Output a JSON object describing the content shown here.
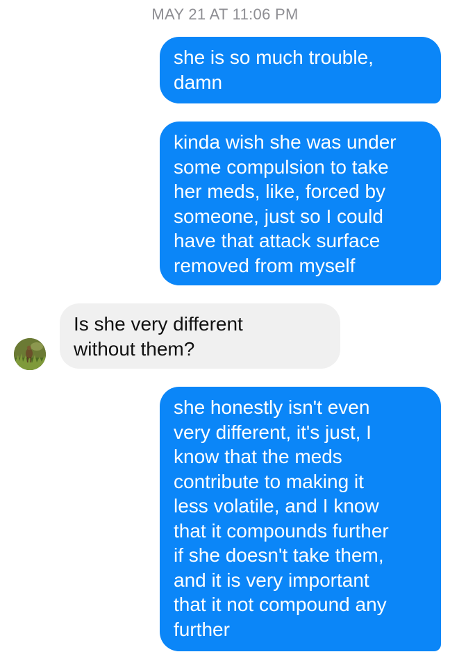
{
  "conversation": {
    "timestamp": "MAY 21 AT 11:06 PM",
    "messages": [
      {
        "direction": "outgoing",
        "lines": [
          "she is so much trouble,",
          "damn"
        ]
      },
      {
        "direction": "outgoing",
        "lines": [
          "kinda wish she was under",
          "some compulsion to take",
          "her meds, like, forced by",
          "someone, just so I could",
          "have that attack surface",
          "removed from myself"
        ]
      },
      {
        "direction": "incoming",
        "lines": [
          "Is she very different",
          "without them?"
        ]
      },
      {
        "direction": "outgoing",
        "lines": [
          "she honestly isn't even",
          "very different, it's just, I",
          "know that the meds",
          "contribute to making it",
          "less volatile, and I know",
          "that it compounds further",
          "if she doesn't take them,",
          "and it is very important",
          "that it not compound any",
          "further"
        ]
      }
    ]
  },
  "colors": {
    "outgoing_bubble": "#0b86f8",
    "incoming_bubble": "#f0f0f0",
    "timestamp_text": "#8e8e93"
  },
  "icons": {
    "contact_avatar": "avatar-photo-deer-in-grass"
  }
}
